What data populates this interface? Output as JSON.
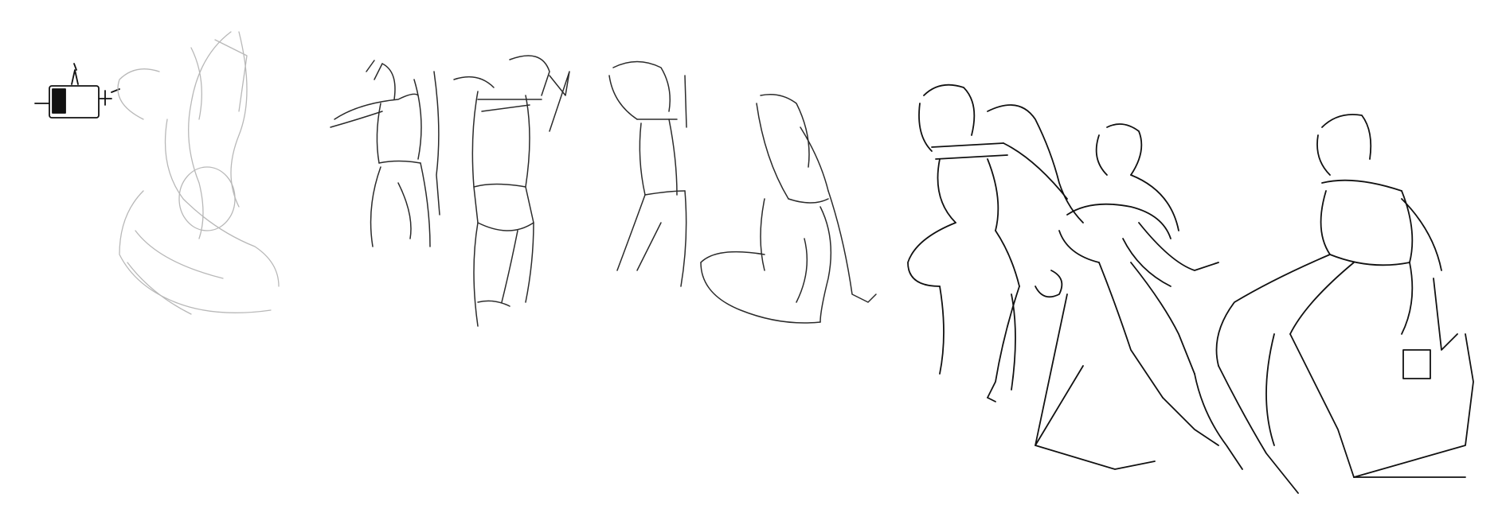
{
  "image": {
    "background_color": "#ffffff",
    "stroke_colors": {
      "light_sketch": "#b8b8b8",
      "dark_sketch": "#111111"
    },
    "figures": [
      {
        "name": "icon-thumbnail",
        "style": "dark"
      },
      {
        "name": "arched-torso",
        "style": "light"
      },
      {
        "name": "standing-back-1",
        "style": "mid"
      },
      {
        "name": "standing-back-2",
        "style": "mid"
      },
      {
        "name": "standing-back-3",
        "style": "mid"
      },
      {
        "name": "kneeling-figure",
        "style": "mid"
      },
      {
        "name": "seated-lunge",
        "style": "dark"
      },
      {
        "name": "seated-leaning",
        "style": "dark"
      },
      {
        "name": "seated-on-block",
        "style": "dark"
      }
    ]
  }
}
